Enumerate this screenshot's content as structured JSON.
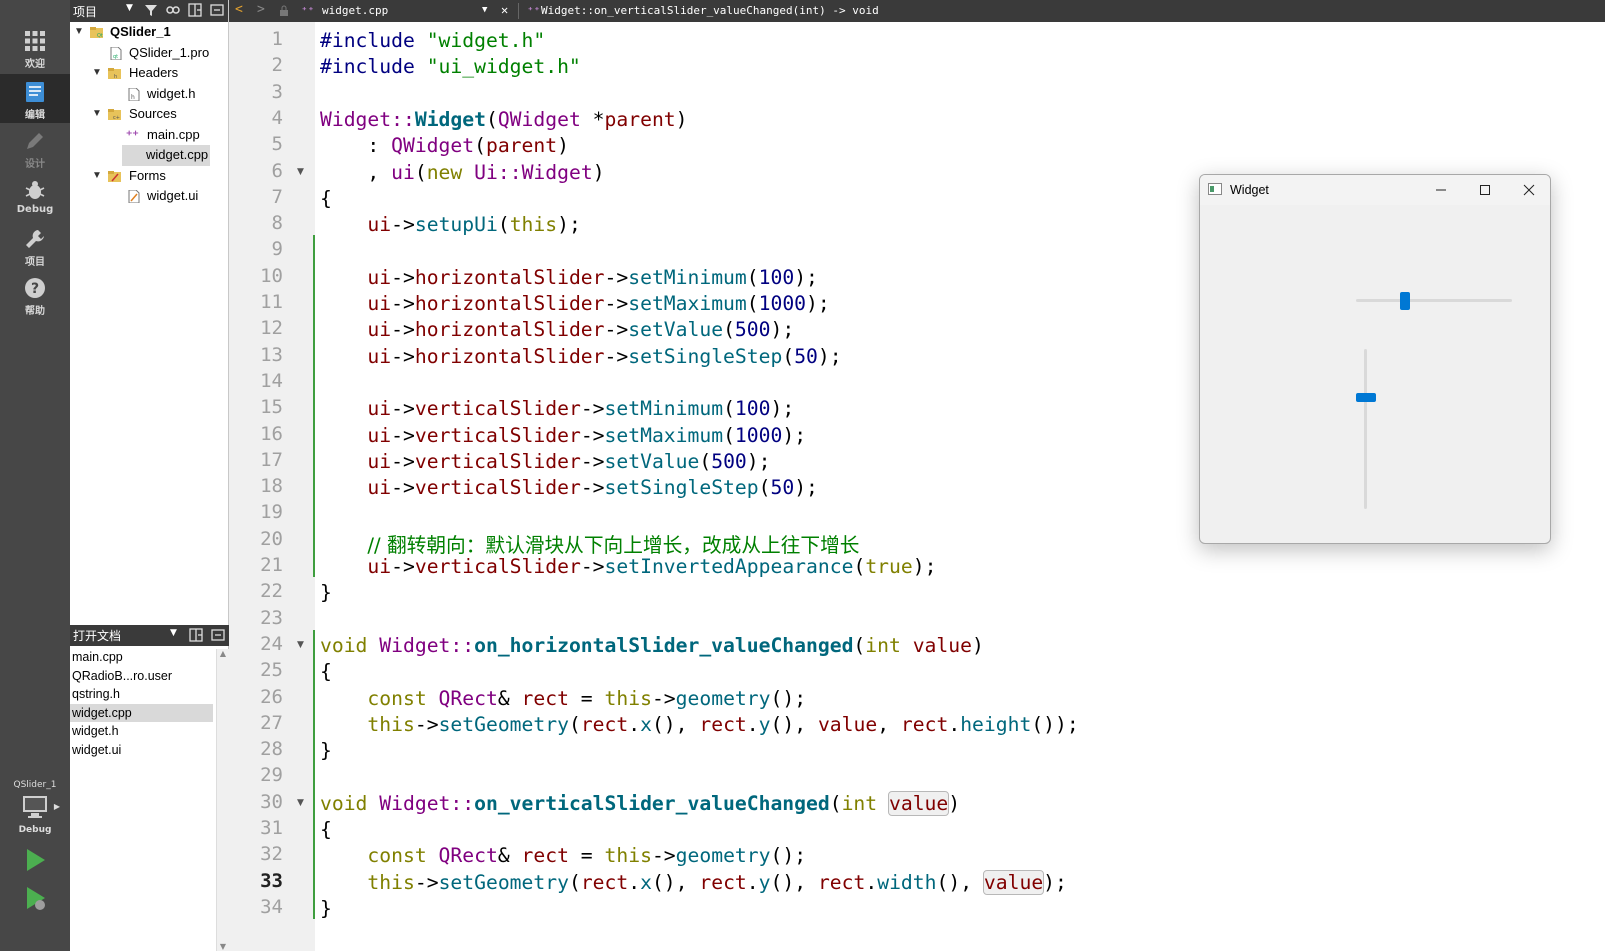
{
  "modebar": {
    "modes": [
      {
        "label": "欢迎",
        "icon": "grid-icon"
      },
      {
        "label": "编辑",
        "icon": "edit-icon"
      },
      {
        "label": "设计",
        "icon": "pencil-icon"
      },
      {
        "label": "Debug",
        "icon": "bug-icon"
      },
      {
        "label": "项目",
        "icon": "wrench-icon"
      },
      {
        "label": "帮助",
        "icon": "help-icon"
      }
    ],
    "target_name": "QSlider_1",
    "target_config": "Debug"
  },
  "project_panel": {
    "title": "项目",
    "tree": [
      {
        "label": "QSlider_1"
      },
      {
        "label": "QSlider_1.pro"
      },
      {
        "label": "Headers"
      },
      {
        "label": "widget.h"
      },
      {
        "label": "Sources"
      },
      {
        "label": "main.cpp"
      },
      {
        "label": "widget.cpp"
      },
      {
        "label": "Forms"
      },
      {
        "label": "widget.ui"
      }
    ]
  },
  "open_docs": {
    "title": "打开文档",
    "items": [
      "main.cpp",
      "QRadioB...ro.user",
      "qstring.h",
      "widget.cpp",
      "widget.h",
      "widget.ui"
    ],
    "selected": "widget.cpp"
  },
  "editor_bar": {
    "file": "widget.cpp",
    "symbol": "Widget::on_verticalSlider_valueChanged(int) -> void"
  },
  "editor": {
    "current_line": 33,
    "lines": [
      "#include \"widget.h\"",
      "#include \"ui_widget.h\"",
      "",
      "Widget::Widget(QWidget *parent)",
      "    : QWidget(parent)",
      "    , ui(new Ui::Widget)",
      "{",
      "    ui->setupUi(this);",
      "",
      "    ui->horizontalSlider->setMinimum(100);",
      "    ui->horizontalSlider->setMaximum(1000);",
      "    ui->horizontalSlider->setValue(500);",
      "    ui->horizontalSlider->setSingleStep(50);",
      "",
      "    ui->verticalSlider->setMinimum(100);",
      "    ui->verticalSlider->setMaximum(1000);",
      "    ui->verticalSlider->setValue(500);",
      "    ui->verticalSlider->setSingleStep(50);",
      "",
      "    // 翻转朝向：默认滑块从下向上增长，改成从上往下增长",
      "    ui->verticalSlider->setInvertedAppearance(true);",
      "}",
      "",
      "void Widget::on_horizontalSlider_valueChanged(int value)",
      "{",
      "    const QRect& rect = this->geometry();",
      "    this->setGeometry(rect.x(), rect.y(), value, rect.height());",
      "}",
      "",
      "void Widget::on_verticalSlider_valueChanged(int value)",
      "{",
      "    const QRect& rect = this->geometry();",
      "    this->setGeometry(rect.x(), rect.y(), rect.width(), value);",
      "}"
    ]
  },
  "widget_window": {
    "title": "Widget",
    "horizontal_slider_position": 0.3,
    "vertical_slider_position": 0.29
  },
  "colors": {
    "keyword": "#808000",
    "type": "#800080",
    "function": "#00677c",
    "member": "#800000",
    "number": "#000080",
    "string": "#008000",
    "comment": "#008000",
    "slider_accent": "#0078d4",
    "change_marker": "#3f9e3f"
  }
}
